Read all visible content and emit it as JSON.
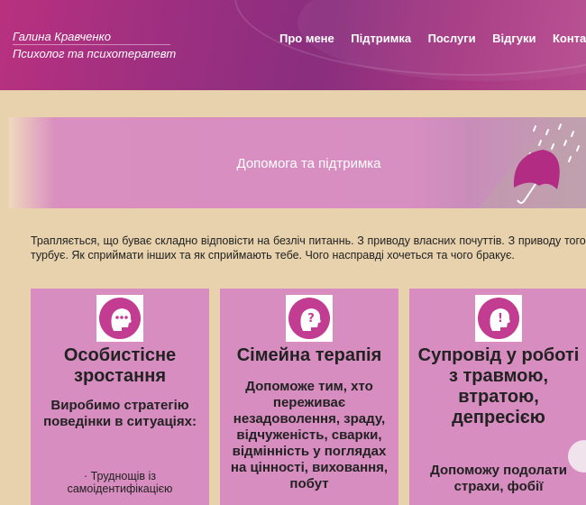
{
  "header": {
    "name": "Галина Кравченко",
    "subtitle": "Психолог та психотерапевт",
    "nav": [
      "Про мене",
      "Підтримка",
      "Послуги",
      "Відгуки",
      "Контакт"
    ]
  },
  "hero": {
    "title": "Допомога та підтримка"
  },
  "intro": "Трапляється, що буває складно відповісти на безліч питаннь. З приводу власних почуттів. З приводу того, що турбує. Як сприймати інших та як сприймають тебе. Чого насправді хочеться та чого бракує.",
  "cards": [
    {
      "icon": "head-speech-icon",
      "title": "Особистісне зростання",
      "desc": "Виробимо стратегію поведінки в ситуаціях:",
      "small": "· Труднощів із самоідентифікацією"
    },
    {
      "icon": "head-question-icon",
      "title": "Сімейна терапія",
      "desc": "Допоможе тим, хто переживає незадоволення, зраду, відчуженість, сварки, відмінність у поглядах на цінності, виховання, побут"
    },
    {
      "icon": "head-exclamation-icon",
      "title": "Супровід у роботі з травмою, втратою, депресією",
      "desc": "Допоможу подолати страхи, фобії"
    }
  ],
  "colors": {
    "header": "#9c2f80",
    "card": "#d78dc0",
    "icon": "#c23c92",
    "background": "#e8d2ad"
  }
}
